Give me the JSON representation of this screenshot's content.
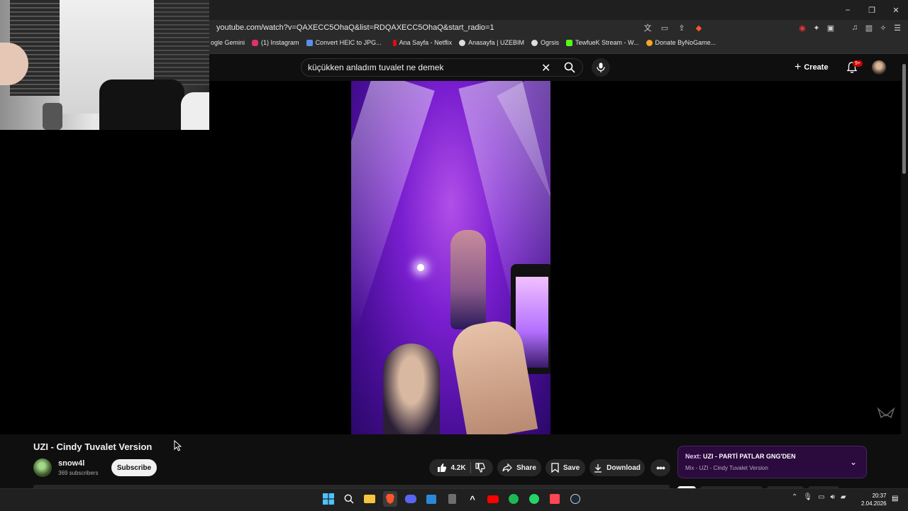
{
  "browser": {
    "url": "youtube.com/watch?v=QAXECC5OhaQ&list=RDQAXECC5OhaQ&start_radio=1",
    "window_controls": [
      "–",
      "❐",
      "✕"
    ],
    "bookmarks": [
      {
        "label": "ogle Gemini",
        "color": "#4285f4"
      },
      {
        "label": "(1) Instagram",
        "color": "#e1306c"
      },
      {
        "label": "Convert HEIC to JPG...",
        "color": "#5b8def"
      },
      {
        "label": "Ana Sayfa - Netflix",
        "color": "#e50914"
      },
      {
        "label": "Anasayfa | UZEBIM",
        "color": "#dddddd"
      },
      {
        "label": "Ogrsis",
        "color": "#dddddd"
      },
      {
        "label": "TewfueK Stream - W...",
        "color": "#53fc18"
      },
      {
        "label": "Donate ByNoGame...",
        "color": "#f5a623"
      }
    ]
  },
  "header": {
    "search_query": "küçükken anladım tuvalet ne demek",
    "create_label": "Create",
    "notification_badge": "9+"
  },
  "video": {
    "title": "UZI - Cindy Tuvalet Version",
    "channel": "snow4l",
    "subscribers": "369 subscribers",
    "subscribe_label": "Subscribe",
    "likes": "4.2K",
    "share_label": "Share",
    "save_label": "Save",
    "download_label": "Download"
  },
  "next": {
    "prefix": "Next:",
    "title": "UZI - PARTİ PATLAR GNG'DEN",
    "subtitle": "Mix - UZI - Cindy Tuvalet Version"
  },
  "taskbar": {
    "time": "20:37",
    "date": "2.04.2026"
  }
}
